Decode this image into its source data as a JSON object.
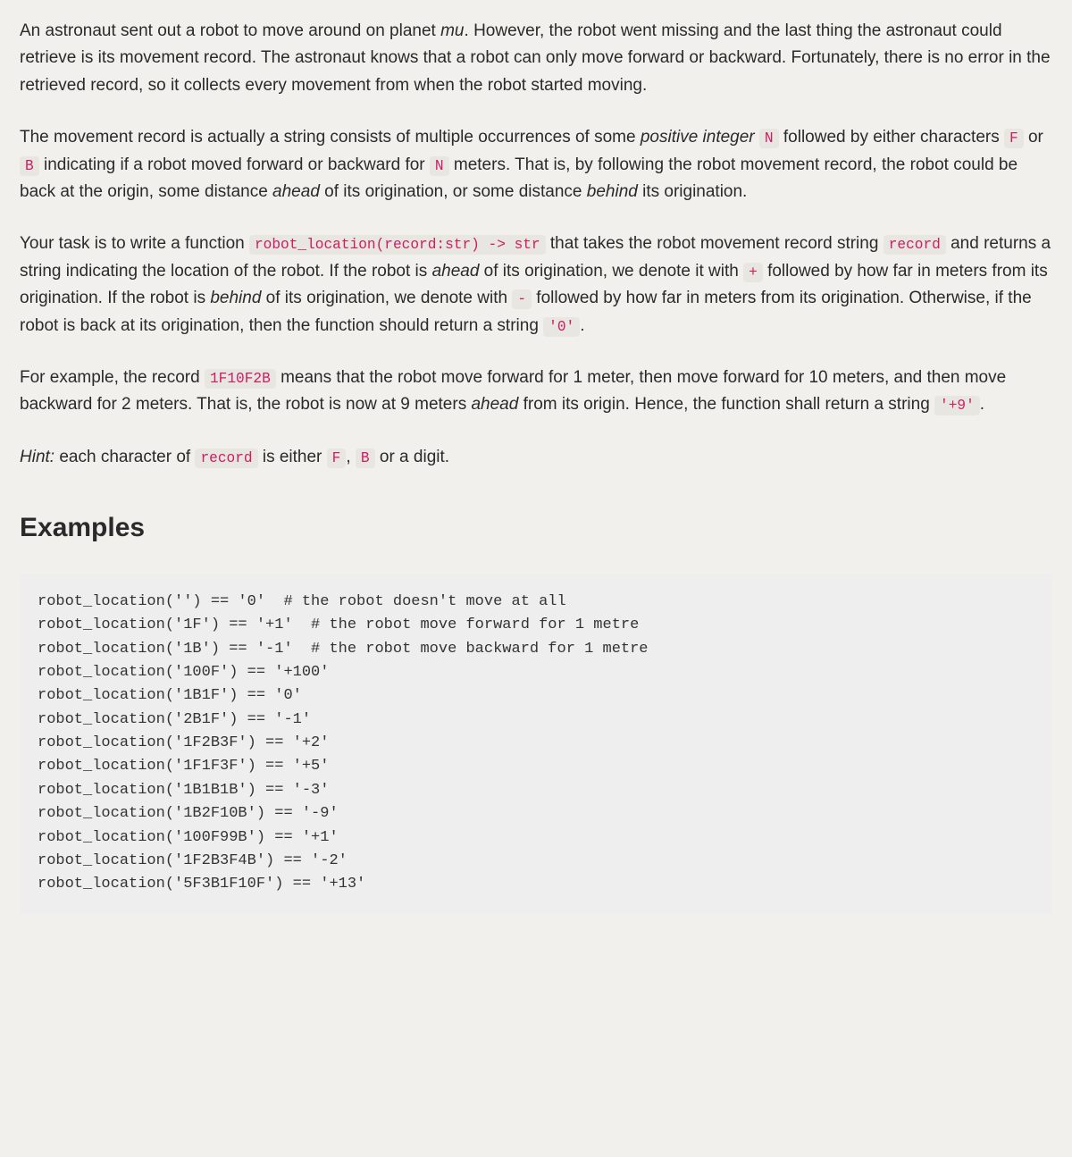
{
  "p1": {
    "t1": "An astronaut sent out a robot to move around on planet ",
    "mu": "mu",
    "t2": ". However, the robot went missing and the last thing the astronaut could retrieve is its movement record. The astronaut knows that a robot can only move forward or backward. Fortunately, there is no error in the retrieved record, so it collects every movement from when the robot started moving."
  },
  "p2": {
    "t1": "The movement record is actually a string consists of multiple occurrences of some ",
    "posint": "positive integer",
    "sp1": " ",
    "N1": "N",
    "t2": " followed by either characters ",
    "F": "F",
    "t3": " or ",
    "B": "B",
    "t4": " indicating if a robot moved forward or backward for ",
    "N2": "N",
    "t5": " meters. That is, by following the robot movement record, the robot could be back at the origin, some distance ",
    "ahead": "ahead",
    "t6": " of its origination, or some distance ",
    "behind": "behind",
    "t7": " its origination."
  },
  "p3": {
    "t1": "Your task is to write a function ",
    "sig": "robot_location(record:str) -> str",
    "t2": " that takes the robot movement record string ",
    "rec1": "record",
    "t3": " and returns a string indicating the location of the robot. If the robot is ",
    "ahead": "ahead",
    "t4": " of its origination, we denote it with ",
    "plus": "+",
    "t5": " followed by how far in meters from its origination. If the robot is ",
    "behind": "behind",
    "t6": " of its origination, we denote with ",
    "minus": "-",
    "t7": " followed by how far in meters from its origination. Otherwise, if the robot is back at its origination, then the function should return a string ",
    "zero": "'0'",
    "t8": "."
  },
  "p4": {
    "t1": "For example, the record ",
    "ex": "1F10F2B",
    "t2": " means that the robot move forward for 1 meter, then move forward for 10 meters, and then move backward for 2 meters. That is, the robot is now at 9 meters ",
    "ahead": "ahead",
    "t3": " from its origin. Hence, the function shall return a string ",
    "ret": "'+9'",
    "t4": "."
  },
  "p5": {
    "hint": "Hint:",
    "t1": " each character of ",
    "rec": "record",
    "t2": " is either ",
    "F": "F",
    "t3": ", ",
    "B": "B",
    "t4": " or a digit."
  },
  "examples_heading": "Examples",
  "codeblock": "robot_location('') == '0'  # the robot doesn't move at all\nrobot_location('1F') == '+1'  # the robot move forward for 1 metre\nrobot_location('1B') == '-1'  # the robot move backward for 1 metre\nrobot_location('100F') == '+100'\nrobot_location('1B1F') == '0'\nrobot_location('2B1F') == '-1'\nrobot_location('1F2B3F') == '+2'\nrobot_location('1F1F3F') == '+5'\nrobot_location('1B1B1B') == '-3'\nrobot_location('1B2F10B') == '-9'\nrobot_location('100F99B') == '+1'\nrobot_location('1F2B3F4B') == '-2'\nrobot_location('5F3B1F10F') == '+13'"
}
